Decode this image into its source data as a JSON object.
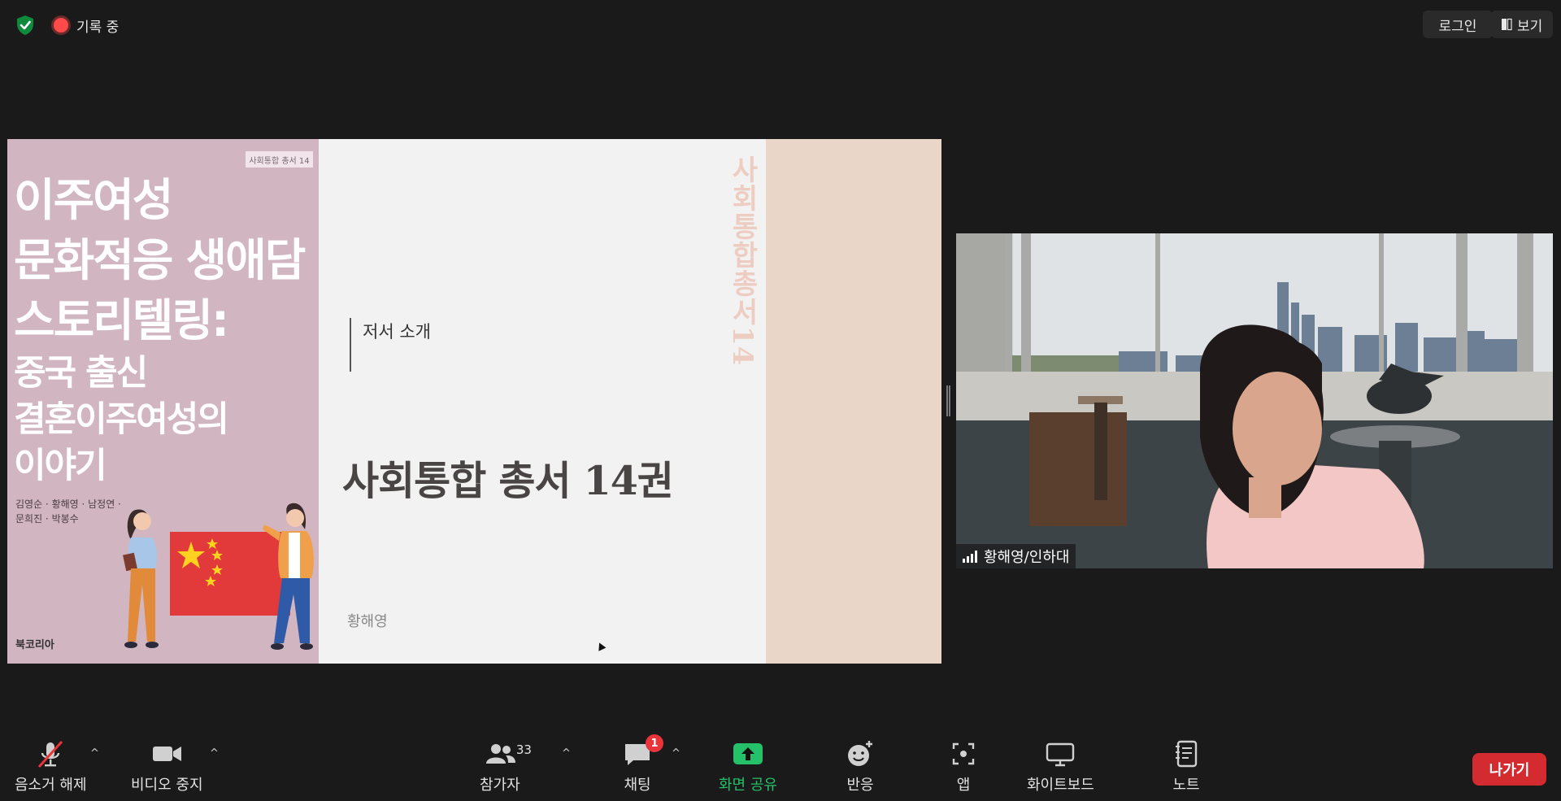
{
  "top_bar": {
    "recording_label": "기록 중",
    "login_label": "로그인",
    "view_label": "보기"
  },
  "slide": {
    "cover": {
      "series_tag": "사회통합 총서 14",
      "title_lines": [
        "이주여성",
        "문화적응 생애담",
        "스토리텔링:"
      ],
      "subtitle_lines": [
        "중국 출신",
        "결혼이주여성의",
        "이야기"
      ],
      "authors_line1": "김영순 · 황해영 · 남정연 ·",
      "authors_line2": "문희진 · 박봉수",
      "publisher": "북코리아"
    },
    "vertical_title": "사회통합총서14",
    "section_label": "저서 소개",
    "title": "사회통합 총서 14권",
    "presenter": "황해영"
  },
  "video": {
    "participant_name": "황해영/인하대"
  },
  "toolbar": {
    "mute_label": "음소거 해제",
    "video_label": "비디오 중지",
    "participants_label": "참가자",
    "participants_count": "33",
    "chat_label": "채팅",
    "chat_badge": "1",
    "share_label": "화면 공유",
    "reactions_label": "반응",
    "apps_label": "앱",
    "whiteboard_label": "화이트보드",
    "notes_label": "노트",
    "leave_label": "나가기"
  },
  "colors": {
    "background": "#1a1a1a",
    "share_green": "#25c06a",
    "leave_red": "#d42b31",
    "badge_red": "#e8343a"
  }
}
